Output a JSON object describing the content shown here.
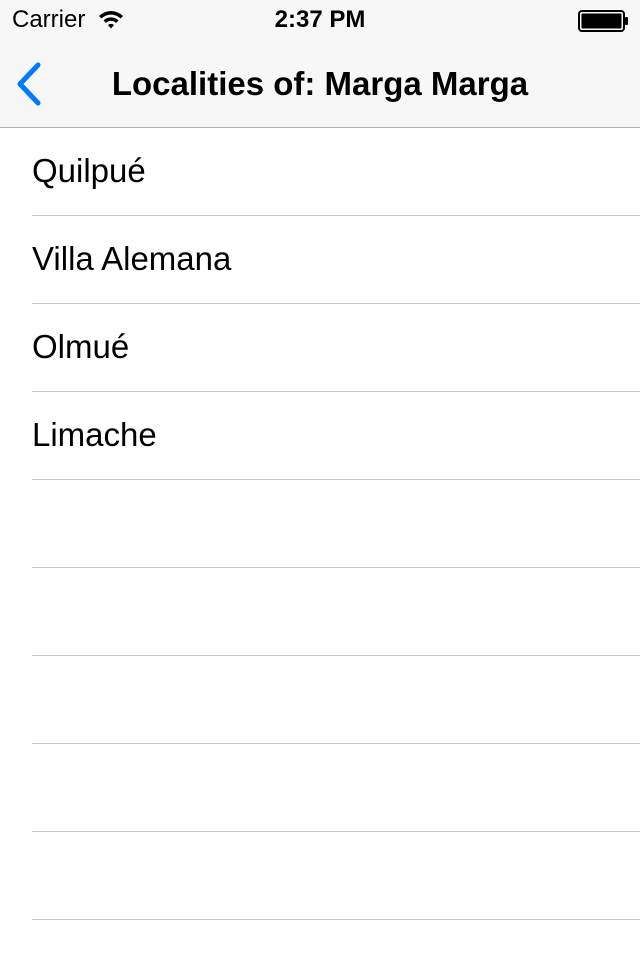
{
  "status_bar": {
    "carrier": "Carrier",
    "time": "2:37 PM",
    "icons": [
      "wifi-icon",
      "battery-icon"
    ]
  },
  "nav_bar": {
    "back_icon": "chevron-left-icon",
    "title": "Localities of: Marga Marga",
    "accent_color": "#007aff"
  },
  "table": {
    "rows": [
      "Quilpué",
      "Villa Alemana",
      "Olmué",
      "Limache",
      "",
      "",
      "",
      "",
      "",
      ""
    ]
  }
}
